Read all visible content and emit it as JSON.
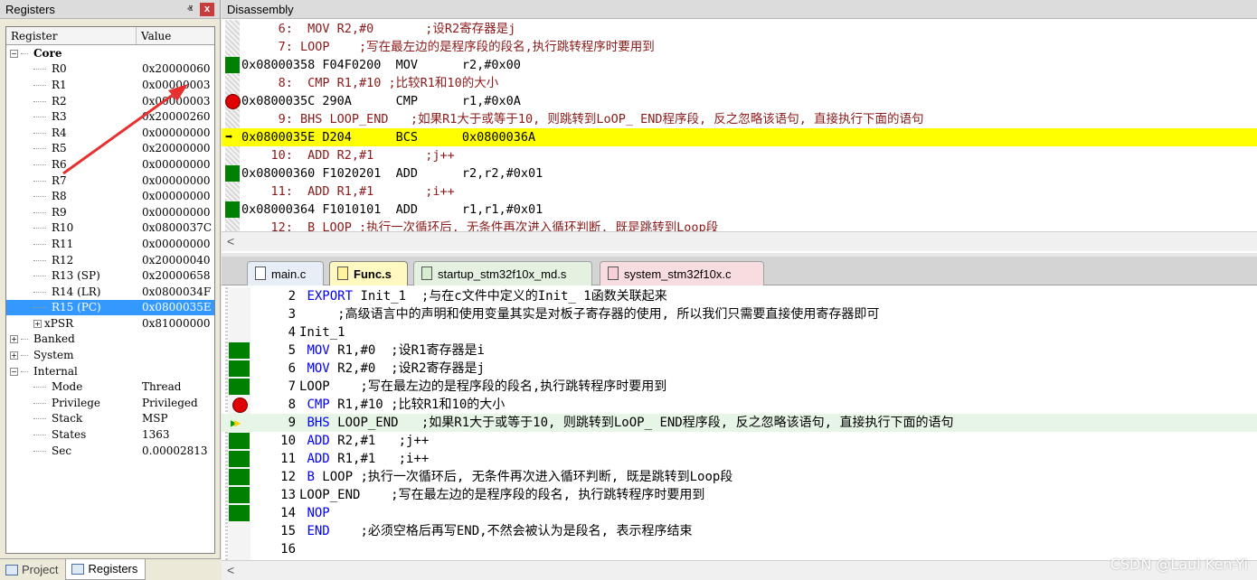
{
  "registers": {
    "title": "Registers",
    "pin_glyph": "ⱏ",
    "close_glyph": "x",
    "col_register": "Register",
    "col_value": "Value",
    "rows": [
      {
        "name": "Core",
        "value": "",
        "level": 0,
        "expander": "−",
        "bold": true
      },
      {
        "name": "R0",
        "value": "0x20000060",
        "level": 1
      },
      {
        "name": "R1",
        "value": "0x00000003",
        "level": 1
      },
      {
        "name": "R2",
        "value": "0x00000003",
        "level": 1
      },
      {
        "name": "R3",
        "value": "0x20000260",
        "level": 1
      },
      {
        "name": "R4",
        "value": "0x00000000",
        "level": 1
      },
      {
        "name": "R5",
        "value": "0x20000000",
        "level": 1
      },
      {
        "name": "R6",
        "value": "0x00000000",
        "level": 1
      },
      {
        "name": "R7",
        "value": "0x00000000",
        "level": 1
      },
      {
        "name": "R8",
        "value": "0x00000000",
        "level": 1
      },
      {
        "name": "R9",
        "value": "0x00000000",
        "level": 1
      },
      {
        "name": "R10",
        "value": "0x0800037C",
        "level": 1
      },
      {
        "name": "R11",
        "value": "0x00000000",
        "level": 1
      },
      {
        "name": "R12",
        "value": "0x20000040",
        "level": 1
      },
      {
        "name": "R13 (SP)",
        "value": "0x20000658",
        "level": 1
      },
      {
        "name": "R14 (LR)",
        "value": "0x0800034F",
        "level": 1
      },
      {
        "name": "R15 (PC)",
        "value": "0x0800035E",
        "level": 1,
        "selected": true
      },
      {
        "name": "xPSR",
        "value": "0x81000000",
        "level": 1,
        "expander": "+"
      },
      {
        "name": "Banked",
        "value": "",
        "level": 0,
        "expander": "+"
      },
      {
        "name": "System",
        "value": "",
        "level": 0,
        "expander": "+"
      },
      {
        "name": "Internal",
        "value": "",
        "level": 0,
        "expander": "−"
      },
      {
        "name": "Mode",
        "value": "Thread",
        "level": 1
      },
      {
        "name": "Privilege",
        "value": "Privileged",
        "level": 1
      },
      {
        "name": "Stack",
        "value": "MSP",
        "level": 1
      },
      {
        "name": "States",
        "value": "1363",
        "level": 1
      },
      {
        "name": "Sec",
        "value": "0.00002813",
        "level": 1
      }
    ]
  },
  "bottom_tabs": {
    "project": "Project",
    "registers": "Registers"
  },
  "disassembly": {
    "title": "Disassembly",
    "lines": [
      {
        "text": "     6:  MOV R2,#0       ;设R2寄存器是j",
        "kind": "src",
        "marker": ""
      },
      {
        "text": "     7: LOOP    ;写在最左边的是程序段的段名,执行跳转程序时要用到",
        "kind": "src",
        "marker": ""
      },
      {
        "text": "0x08000358 F04F0200  MOV      r2,#0x00",
        "kind": "asm",
        "marker": "green"
      },
      {
        "text": "     8:  CMP R1,#10 ;比较R1和10的大小",
        "kind": "src",
        "marker": ""
      },
      {
        "text": "0x0800035C 290A      CMP      r1,#0x0A",
        "kind": "asm",
        "marker": "bp"
      },
      {
        "text": "     9: BHS LOOP_END   ;如果R1大于或等于10, 则跳转到LoOP_ END程序段, 反之忽略该语句, 直接执行下面的语句",
        "kind": "src",
        "marker": ""
      },
      {
        "text": "0x0800035E D204      BCS      0x0800036A",
        "kind": "asm",
        "marker": "arrow",
        "current": true
      },
      {
        "text": "    10:  ADD R2,#1       ;j++",
        "kind": "src",
        "marker": ""
      },
      {
        "text": "0x08000360 F1020201  ADD      r2,r2,#0x01",
        "kind": "asm",
        "marker": "green"
      },
      {
        "text": "    11:  ADD R1,#1       ;i++",
        "kind": "src",
        "marker": ""
      },
      {
        "text": "0x08000364 F1010101  ADD      r1,r1,#0x01",
        "kind": "asm",
        "marker": "green"
      },
      {
        "text": "    12:  B LOOP ;执行一次循环后, 无条件再次进入循环判断, 既是跳转到Loop段",
        "kind": "src",
        "marker": ""
      }
    ],
    "scroll_left": "<"
  },
  "editor": {
    "tabs": [
      {
        "label": "main.c"
      },
      {
        "label": "Func.s",
        "active": true
      },
      {
        "label": "startup_stm32f10x_md.s"
      },
      {
        "label": "system_stm32f10x.c"
      }
    ],
    "lines": [
      {
        "num": "2",
        "kw": "EXPORT",
        "rest": " Init_1  ;与在c文件中定义的Init_ 1函数关联起来",
        "marker": "",
        "indent": " "
      },
      {
        "num": "3",
        "kw": "",
        "rest": "     ;高级语言中的声明和使用变量其实是对板子寄存器的使用, 所以我们只需要直接使用寄存器即可",
        "marker": "",
        "indent": ""
      },
      {
        "num": "4",
        "kw": "",
        "rest": "Init_1",
        "marker": "",
        "indent": ""
      },
      {
        "num": "5",
        "kw": "MOV",
        "rest": " R1,#0  ;设R1寄存器是i",
        "marker": "green",
        "indent": " "
      },
      {
        "num": "6",
        "kw": "MOV",
        "rest": " R2,#0  ;设R2寄存器是j",
        "marker": "green",
        "indent": " "
      },
      {
        "num": "7",
        "kw": "",
        "rest": "LOOP    ;写在最左边的是程序段的段名,执行跳转程序时要用到",
        "marker": "green",
        "indent": ""
      },
      {
        "num": "8",
        "kw": "CMP",
        "rest": " R1,#10 ;比较R1和10的大小",
        "marker": "bp",
        "indent": " "
      },
      {
        "num": "9",
        "kw": "BHS",
        "rest": " LOOP_END   ;如果R1大于或等于10, 则跳转到LoOP_ END程序段, 反之忽略该语句, 直接执行下面的语句",
        "marker": "dbl",
        "indent": " ",
        "current": true
      },
      {
        "num": "10",
        "kw": "ADD",
        "rest": " R2,#1   ;j++",
        "marker": "green",
        "indent": " "
      },
      {
        "num": "11",
        "kw": "ADD",
        "rest": " R1,#1   ;i++",
        "marker": "green",
        "indent": " "
      },
      {
        "num": "12",
        "kw": "B",
        "rest": " LOOP ;执行一次循环后, 无条件再次进入循环判断, 既是跳转到Loop段",
        "marker": "green",
        "indent": " "
      },
      {
        "num": "13",
        "kw": "",
        "rest": "LOOP_END    ;写在最左边的是程序段的段名, 执行跳转程序时要用到",
        "marker": "green",
        "indent": ""
      },
      {
        "num": "14",
        "kw": "NOP",
        "rest": "",
        "marker": "green",
        "indent": " "
      },
      {
        "num": "15",
        "kw": "END",
        "rest": "    ;必须空格后再写END,不然会被认为是段名, 表示程序结束",
        "marker": "",
        "indent": " "
      },
      {
        "num": "16",
        "kw": "",
        "rest": "",
        "marker": "",
        "indent": ""
      }
    ],
    "scroll_left": "<"
  },
  "watermark": "CSDN @Laul Ken-Yi",
  "colors": {
    "current_line": "#ffff00",
    "execution_marker": "#008000",
    "breakpoint": "#e00000",
    "keyword": "#0000ff",
    "source_comment": "#8b1a1a",
    "selection": "#3399ff",
    "annotation_arrow": "#e83030"
  }
}
